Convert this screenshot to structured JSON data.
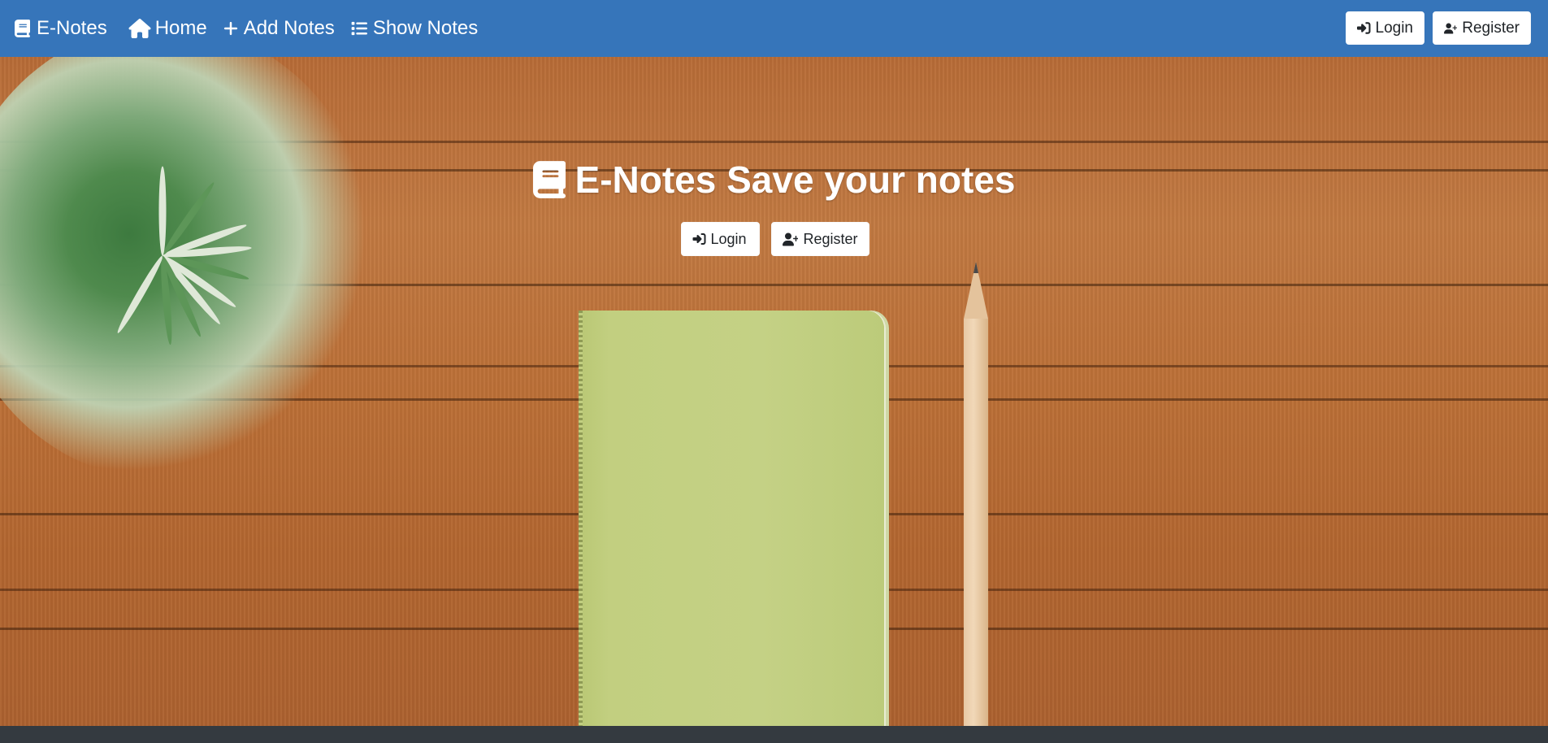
{
  "navbar": {
    "brand": {
      "label": "E-Notes",
      "icon": "book-icon"
    },
    "links": [
      {
        "label": "Home",
        "icon": "home-icon"
      },
      {
        "label": "Add Notes",
        "icon": "plus-icon"
      },
      {
        "label": "Show Notes",
        "icon": "list-icon"
      }
    ],
    "login_label": "Login",
    "register_label": "Register"
  },
  "hero": {
    "title": "E-Notes Save your notes",
    "title_icon": "book-icon",
    "login_label": "Login",
    "register_label": "Register"
  },
  "colors": {
    "navbar": "#3675ba",
    "footer": "#343a40",
    "button_bg": "#ffffff"
  }
}
